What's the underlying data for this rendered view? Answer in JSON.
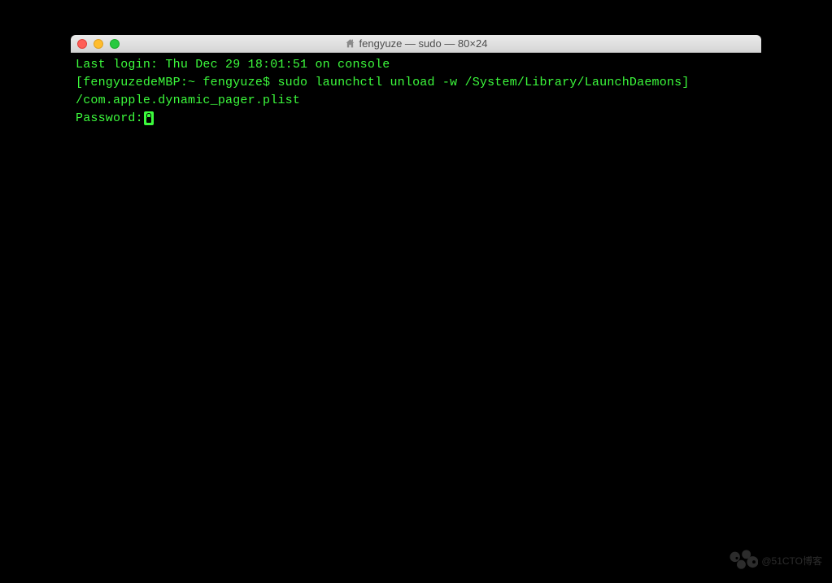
{
  "window": {
    "title": "fengyuze — sudo — 80×24"
  },
  "terminal": {
    "line1": "Last login: Thu Dec 29 18:01:51 on console",
    "line2_bracket_open": "[",
    "line2_prompt": "fengyuzedeMBP:~ fengyuze$ ",
    "line2_command": "sudo launchctl unload -w /System/Library/LaunchDaemons",
    "line2_bracket_close": "]",
    "line3": "/com.apple.dynamic_pager.plist",
    "line4_label": "Password:"
  },
  "watermark": {
    "text": "@51CTO博客"
  }
}
